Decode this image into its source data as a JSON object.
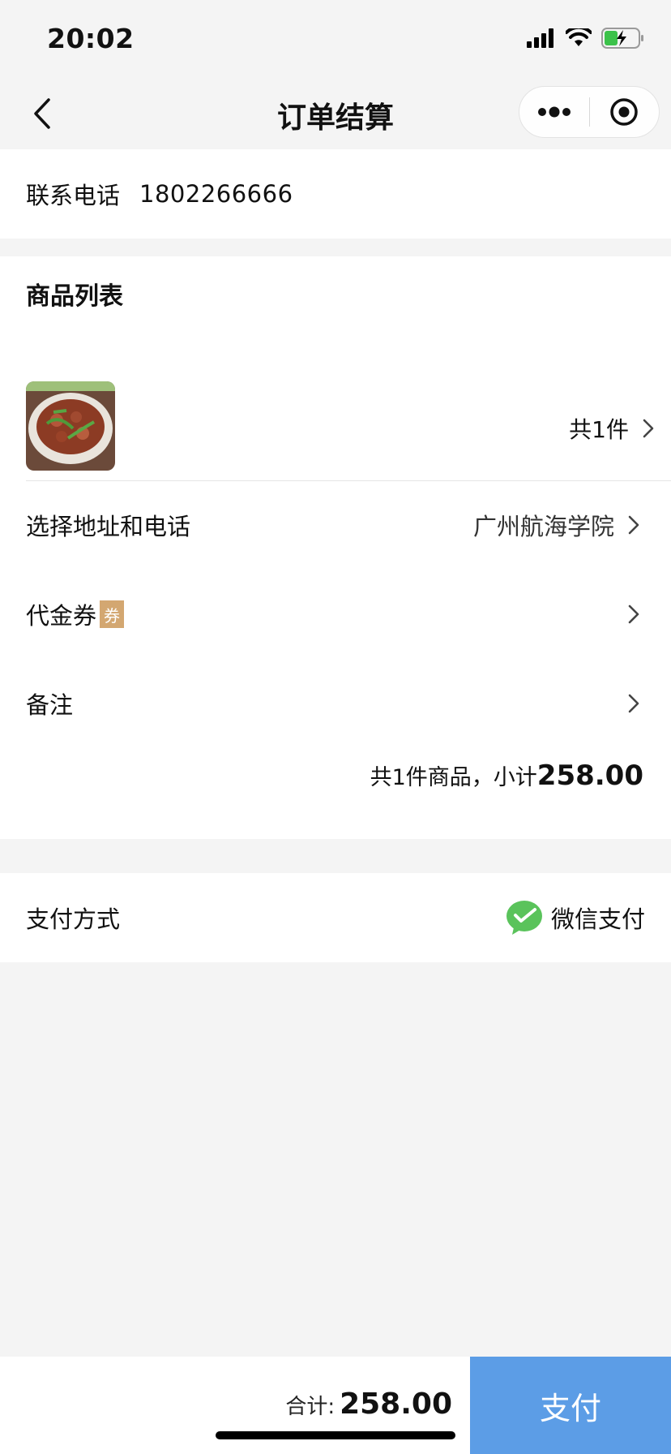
{
  "status_bar": {
    "time": "20:02"
  },
  "nav": {
    "title": "订单结算"
  },
  "contact": {
    "label": "联系电话",
    "phone": "1802266666"
  },
  "goods": {
    "title": "商品列表",
    "count_label": "共1件",
    "address": {
      "label": "选择地址和电话",
      "value": "广州航海学院"
    },
    "voucher": {
      "label": "代金券",
      "badge": "券"
    },
    "note": {
      "label": "备注"
    },
    "subtotal": {
      "prefix": "共1件商品，小计",
      "amount": "258.00"
    }
  },
  "payment": {
    "label": "支付方式",
    "method": "微信支付"
  },
  "bottom": {
    "total_label": "合计:",
    "total_amount": "258.00",
    "pay_button": "支付"
  },
  "colors": {
    "pay_button": "#5c9de6",
    "voucher_badge": "#d3a771",
    "wechat_green": "#5ac35b"
  }
}
